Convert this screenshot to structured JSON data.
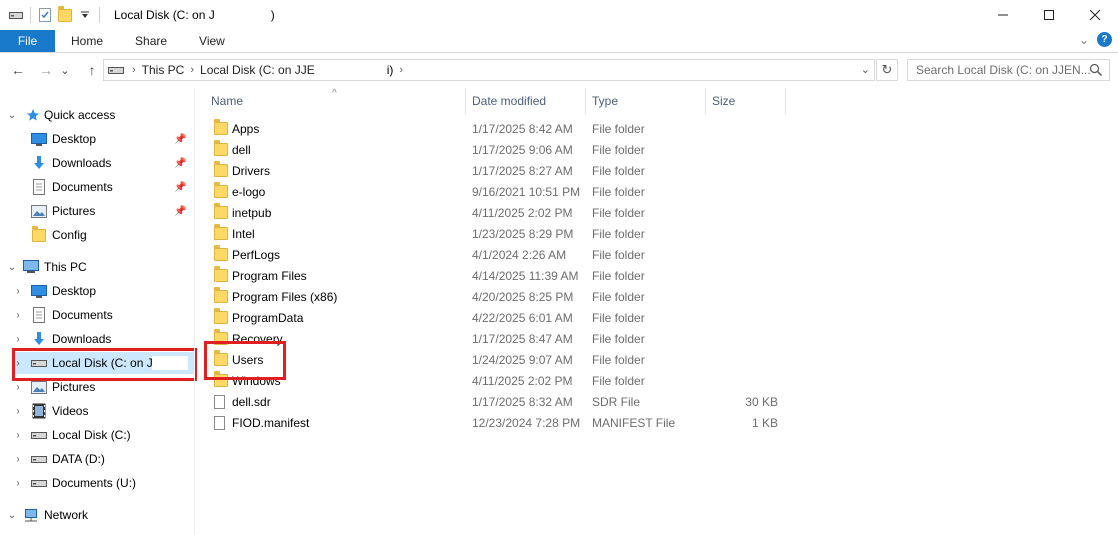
{
  "window": {
    "title": "Local Disk (C: on J",
    "title_end": ")",
    "minimize": "—",
    "maximize": "☐",
    "close": "✕"
  },
  "ribbon": {
    "tabs": [
      "File",
      "Home",
      "Share",
      "View"
    ],
    "expand_glyph": "⌄",
    "help": "?"
  },
  "nav": {
    "back": "←",
    "forward": "→",
    "recent": "⌄",
    "up": "↑",
    "crumbs": [
      "This PC",
      "Local Disk (C: on JJE",
      "i)"
    ],
    "refresh": "↻",
    "search_placeholder": "Search Local Disk (C: on JJEN..."
  },
  "sidebar": {
    "quick_access": {
      "label": "Quick access",
      "items": [
        {
          "label": "Desktop",
          "icon": "desktop-icon",
          "pinned": true
        },
        {
          "label": "Downloads",
          "icon": "downloads-icon",
          "pinned": true
        },
        {
          "label": "Documents",
          "icon": "documents-icon",
          "pinned": true
        },
        {
          "label": "Pictures",
          "icon": "pictures-icon",
          "pinned": true
        },
        {
          "label": "Config",
          "icon": "folder-icon",
          "pinned": false
        }
      ]
    },
    "this_pc": {
      "label": "This PC",
      "items": [
        {
          "label": "Desktop",
          "icon": "desktop-icon"
        },
        {
          "label": "Documents",
          "icon": "documents-icon"
        },
        {
          "label": "Downloads",
          "icon": "downloads-icon"
        },
        {
          "label": "Local Disk (C: on JJ",
          "icon": "drive-icon",
          "selected": true
        },
        {
          "label": "Pictures",
          "icon": "pictures-icon"
        },
        {
          "label": "Videos",
          "icon": "videos-icon"
        },
        {
          "label": "Local Disk (C:)",
          "icon": "drive-icon"
        },
        {
          "label": "DATA (D:)",
          "icon": "drive-icon"
        },
        {
          "label": "Documents (U:)",
          "icon": "drive-icon"
        }
      ]
    },
    "network": {
      "label": "Network"
    }
  },
  "columns": {
    "name": "Name",
    "date": "Date modified",
    "type": "Type",
    "size": "Size"
  },
  "files": [
    {
      "name": "Apps",
      "date": "1/17/2025 8:42 AM",
      "type": "File folder",
      "size": "",
      "kind": "folder"
    },
    {
      "name": "dell",
      "date": "1/17/2025 9:06 AM",
      "type": "File folder",
      "size": "",
      "kind": "folder"
    },
    {
      "name": "Drivers",
      "date": "1/17/2025 8:27 AM",
      "type": "File folder",
      "size": "",
      "kind": "folder"
    },
    {
      "name": "e-logo",
      "date": "9/16/2021 10:51 PM",
      "type": "File folder",
      "size": "",
      "kind": "folder"
    },
    {
      "name": "inetpub",
      "date": "4/11/2025 2:02 PM",
      "type": "File folder",
      "size": "",
      "kind": "folder"
    },
    {
      "name": "Intel",
      "date": "1/23/2025 8:29 PM",
      "type": "File folder",
      "size": "",
      "kind": "folder"
    },
    {
      "name": "PerfLogs",
      "date": "4/1/2024 2:26 AM",
      "type": "File folder",
      "size": "",
      "kind": "folder"
    },
    {
      "name": "Program Files",
      "date": "4/14/2025 11:39 AM",
      "type": "File folder",
      "size": "",
      "kind": "folder"
    },
    {
      "name": "Program Files (x86)",
      "date": "4/20/2025 8:25 PM",
      "type": "File folder",
      "size": "",
      "kind": "folder"
    },
    {
      "name": "ProgramData",
      "date": "4/22/2025 6:01 AM",
      "type": "File folder",
      "size": "",
      "kind": "folder"
    },
    {
      "name": "Recovery",
      "date": "1/17/2025 8:47 AM",
      "type": "File folder",
      "size": "",
      "kind": "folder"
    },
    {
      "name": "Users",
      "date": "1/24/2025 9:07 AM",
      "type": "File folder",
      "size": "",
      "kind": "folder"
    },
    {
      "name": "Windows",
      "date": "4/11/2025 2:02 PM",
      "type": "File folder",
      "size": "",
      "kind": "folder"
    },
    {
      "name": "dell.sdr",
      "date": "1/17/2025 8:32 AM",
      "type": "SDR File",
      "size": "30 KB",
      "kind": "file"
    },
    {
      "name": "FIOD.manifest",
      "date": "12/23/2024 7:28 PM",
      "type": "MANIFEST File",
      "size": "1 KB",
      "kind": "file"
    }
  ],
  "colors": {
    "accent": "#1979ca",
    "highlight": "#e02020",
    "selection": "#cce8ff"
  }
}
